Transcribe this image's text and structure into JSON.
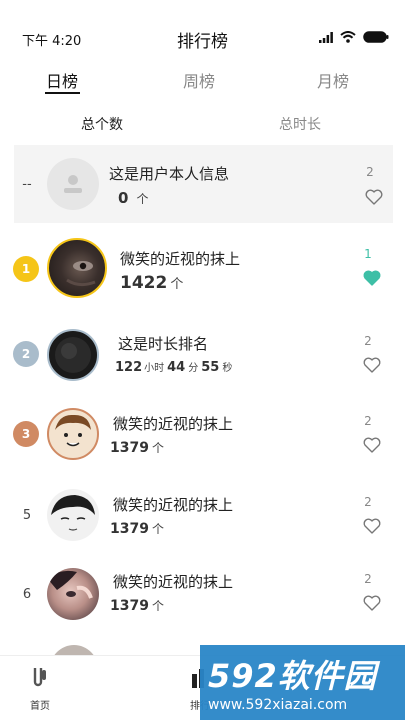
{
  "status_bar": {
    "time": "下午 4:20"
  },
  "header": {
    "title": "排行榜"
  },
  "tabs": [
    {
      "label": "日榜",
      "active": true
    },
    {
      "label": "周榜",
      "active": false
    },
    {
      "label": "月榜",
      "active": false
    }
  ],
  "subtabs": [
    {
      "label": "总个数",
      "active": true
    },
    {
      "label": "总时长",
      "active": false
    }
  ],
  "self": {
    "rank": "--",
    "name": "这是用户本人信息",
    "count": "0",
    "count_unit": "个",
    "likes": "2"
  },
  "rows": [
    {
      "rank": "1",
      "name": "微笑的近视的抹上",
      "count": "1422",
      "count_unit": "个",
      "likes": "1",
      "liked": true,
      "badge_color": "#f5c518"
    },
    {
      "rank": "2",
      "name": "这是时长排名",
      "hours": "122",
      "hours_unit": "小时",
      "minutes": "44",
      "minutes_unit": "分",
      "seconds": "55",
      "seconds_unit": "秒",
      "likes": "2",
      "liked": false,
      "badge_color": "#a9bccb"
    },
    {
      "rank": "3",
      "name": "微笑的近视的抹上",
      "count": "1379",
      "count_unit": "个",
      "likes": "2",
      "liked": false,
      "badge_color": "#d08a63"
    },
    {
      "rank": "5",
      "name": "微笑的近视的抹上",
      "count": "1379",
      "count_unit": "个",
      "likes": "2",
      "liked": false
    },
    {
      "rank": "6",
      "name": "微笑的近视的抹上",
      "count": "1379",
      "count_unit": "个",
      "likes": "2",
      "liked": false
    }
  ],
  "bottom_nav": [
    {
      "label": "首页",
      "icon": "home-icon"
    },
    {
      "label": "排行",
      "icon": "ranking-icon"
    }
  ],
  "watermark": {
    "title": "592软件园",
    "url": "www.592xiazai.com"
  },
  "colors": {
    "accent": "#3dbfa6",
    "watermark_bg": "#2a86c8"
  }
}
